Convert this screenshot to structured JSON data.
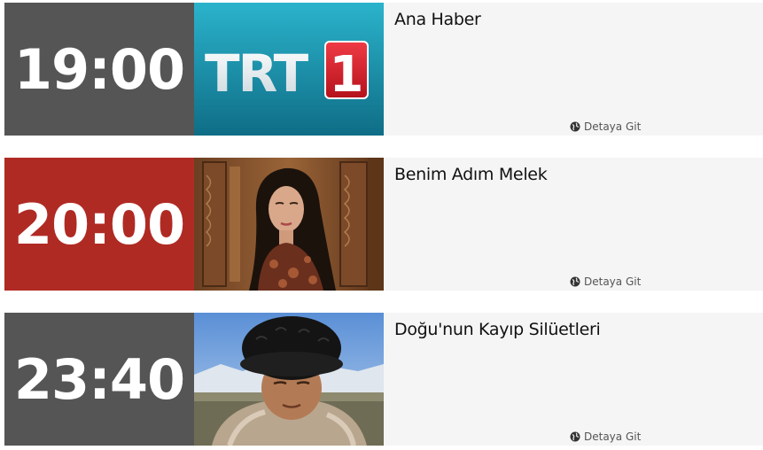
{
  "schedule": [
    {
      "time": "19:00",
      "time_bg": "#555555",
      "title": "Ana Haber",
      "thumb_icon": "trt1-logo-thumbnail",
      "logo_text": "TRT",
      "logo_number": "1",
      "link_label": "Detaya Git"
    },
    {
      "time": "20:00",
      "time_bg": "#b02a24",
      "title": "Benim Adım Melek",
      "thumb_icon": "woman-portrait-thumbnail",
      "link_label": "Detaya Git"
    },
    {
      "time": "23:40",
      "time_bg": "#555555",
      "title": "Doğu'nun Kayıp Silüetleri",
      "thumb_icon": "man-in-fur-hat-thumbnail",
      "link_label": "Detaya Git"
    }
  ],
  "colors": {
    "row_bg": "#f5f5f5",
    "trt_red": "#d0202a",
    "trt_blue": "#1a8fa8"
  }
}
